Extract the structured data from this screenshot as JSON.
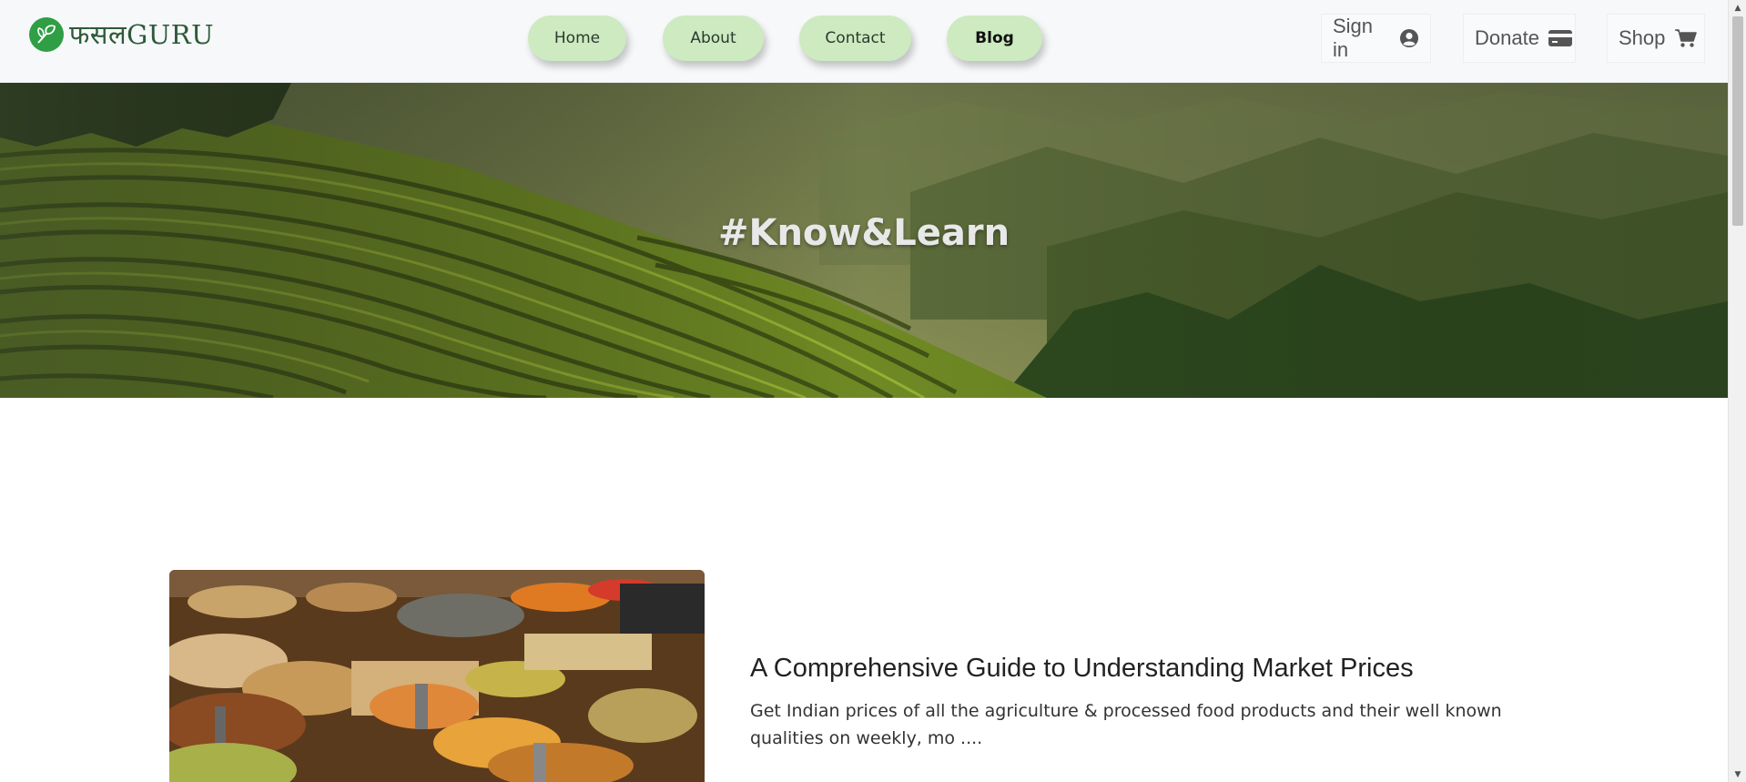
{
  "header": {
    "logo_text": "फसलGURU",
    "nav": [
      {
        "label": "Home"
      },
      {
        "label": "About"
      },
      {
        "label": "Contact"
      },
      {
        "label": "Blog",
        "active": true
      }
    ],
    "signin_label": "Sign in",
    "donate_label": "Donate",
    "shop_label": "Shop",
    "icons": {
      "logo": "sprout-logo-icon",
      "signin": "user-circle-icon",
      "donate": "credit-card-icon",
      "shop": "cart-icon"
    }
  },
  "hero": {
    "title": "#Know&Learn"
  },
  "blog": {
    "posts": [
      {
        "title": "A Comprehensive Guide to Understanding Market Prices",
        "excerpt": "Get Indian prices of all the agriculture & processed food products and their well known qualities on weekly, mo ...."
      }
    ]
  },
  "colors": {
    "nav_pill": "#cdeac0",
    "brand_green": "#2f9e44",
    "header_bg": "#f7f8f9"
  }
}
